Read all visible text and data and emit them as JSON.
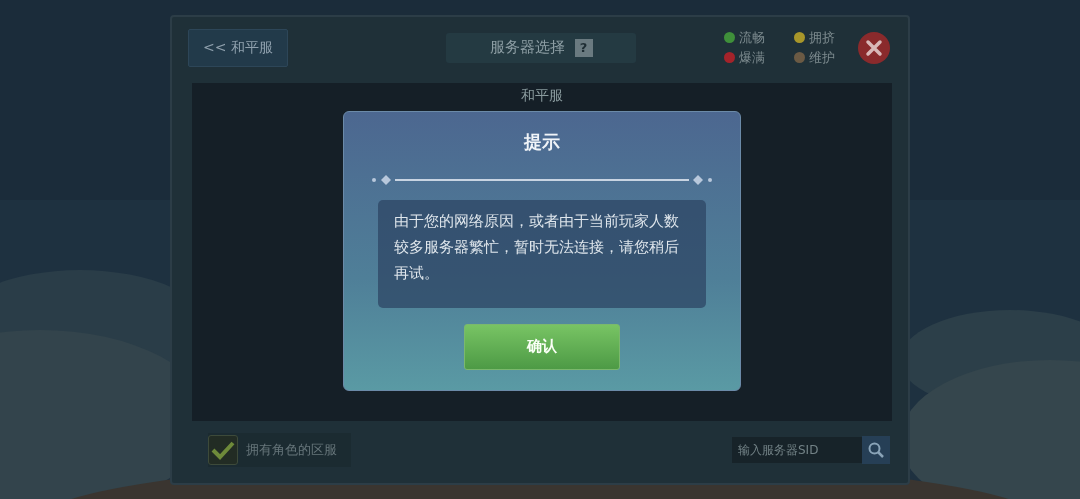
{
  "header": {
    "back_button": "<< 和平服",
    "title": "服务器选择",
    "help": "?"
  },
  "legend": [
    {
      "label": "流畅",
      "color": "#3f8f3a"
    },
    {
      "label": "拥挤",
      "color": "#a8962a"
    },
    {
      "label": "爆满",
      "color": "#a4232a"
    },
    {
      "label": "维护",
      "color": "#6b5a44"
    }
  ],
  "server_list": {
    "heading": "和平服"
  },
  "dialog": {
    "title": "提示",
    "message": "由于您的网络原因，或者由于当前玩家人数较多服务器繁忙，暂时无法连接，请您稍后再试。",
    "confirm": "确认"
  },
  "footer": {
    "filter": {
      "label": "拥有角色的区服",
      "checked": true
    },
    "search": {
      "placeholder": "输入服务器SID"
    }
  }
}
